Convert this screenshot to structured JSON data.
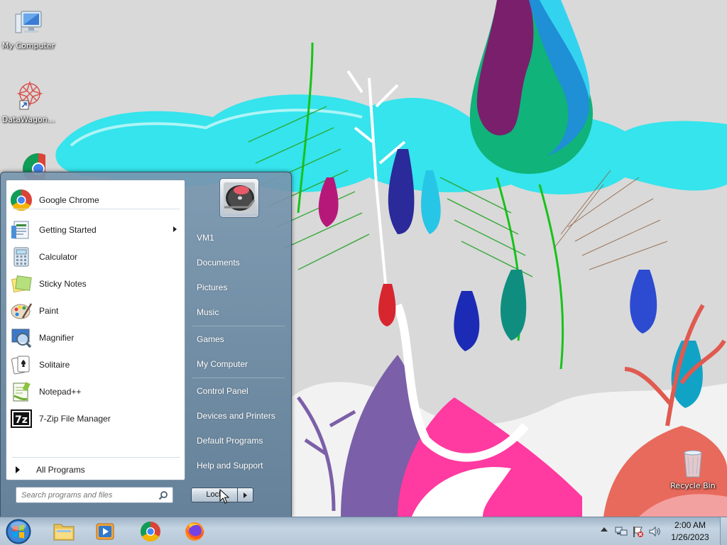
{
  "desktop": {
    "icons": [
      {
        "label": "My Computer",
        "icon": "computer-icon"
      },
      {
        "label": "DataWagon...",
        "icon": "datawagon-shortcut-icon"
      },
      {
        "label": "",
        "icon": "chrome-icon"
      },
      {
        "label": "Recycle Bin",
        "icon": "recycle-bin-icon"
      }
    ]
  },
  "start_menu": {
    "pinned": [
      {
        "label": "Google Chrome",
        "icon": "chrome-icon"
      }
    ],
    "recent": [
      {
        "label": "Getting Started",
        "icon": "getting-started-icon",
        "submenu": true
      },
      {
        "label": "Calculator",
        "icon": "calculator-icon"
      },
      {
        "label": "Sticky Notes",
        "icon": "sticky-notes-icon"
      },
      {
        "label": "Paint",
        "icon": "paint-icon"
      },
      {
        "label": "Magnifier",
        "icon": "magnifier-icon"
      },
      {
        "label": "Solitaire",
        "icon": "solitaire-icon"
      },
      {
        "label": "Notepad++",
        "icon": "notepadpp-icon"
      },
      {
        "label": "7-Zip File Manager",
        "icon": "7zip-icon"
      }
    ],
    "all_programs_label": "All Programs",
    "search_placeholder": "Search programs and files",
    "right_items": {
      "user": "VM1",
      "documents": "Documents",
      "pictures": "Pictures",
      "music": "Music",
      "games": "Games",
      "my_computer": "My Computer",
      "control_panel": "Control Panel",
      "devices_printers": "Devices and Printers",
      "default_programs": "Default Programs",
      "help_support": "Help and Support"
    },
    "lock_label": "Lock"
  },
  "taskbar": {
    "pinned": [
      "file-explorer-icon",
      "media-player-icon",
      "chrome-icon",
      "firefox-icon"
    ],
    "tray": [
      "network-icon",
      "action-center-flag-icon",
      "volume-icon"
    ],
    "clock": {
      "time": "2:00 AM",
      "date": "1/26/2023"
    }
  },
  "colors": {
    "menu_glass": "#7896af",
    "taskbar": "#b6c7d7",
    "sky_cyan": "#2ee6ef"
  }
}
